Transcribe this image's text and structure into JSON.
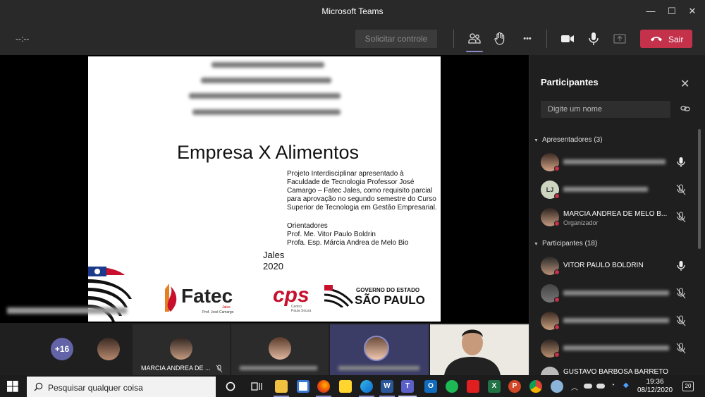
{
  "window": {
    "title": "Microsoft Teams",
    "minimize": "—",
    "maximize": "☐",
    "close": "✕"
  },
  "toolbar": {
    "timer": "--:--",
    "request_control": "Solicitar controle",
    "leave": "Sair",
    "more": "•••",
    "icons": [
      "participants-icon",
      "raise-hand-icon",
      "more-options-icon",
      "camera-icon",
      "microphone-icon",
      "share-tray-icon",
      "hang-up-icon"
    ],
    "leave_color": "#c4314b",
    "accent": "#6264a7"
  },
  "slide": {
    "title": "Empresa X Alimentos",
    "description": "Projeto Interdisciplinar apresentado à Faculdade de Tecnologia Professor José Camargo – Fatec Jales, como requisito parcial para aprovação no segundo semestre do Curso Superior de Tecnologia em Gestão Empresarial.",
    "orientadores_label": "Orientadores",
    "orientador_1": "Prof. Me. Vitor Paulo Boldrin",
    "orientador_2": "Profa. Esp. Márcia Andrea de Melo Bio",
    "city": "Jales",
    "year": "2020",
    "logo_fatec": "Fatec",
    "logo_fatec_sub": "Jales",
    "logo_fatec_sub2": "Prof. José Camargo",
    "logo_cps": "cps",
    "logo_cps_sub1": "Centro",
    "logo_cps_sub2": "Paula Souza",
    "logo_gov_1": "GOVERNO DO ESTADO",
    "logo_gov_2": "SÃO PAULO"
  },
  "gallery": {
    "overflow_count": "+16",
    "tile_name": "MARCIA ANDREA DE ..."
  },
  "panel": {
    "title": "Participantes",
    "search_placeholder": "Digite um nome",
    "presenters_header": "Apresentadores (3)",
    "participants_header": "Participantes (18)",
    "presenters": [
      {
        "initials": "",
        "name": "",
        "role": "",
        "mic": "on"
      },
      {
        "initials": "LJ",
        "name": "",
        "role": "",
        "mic": "muted"
      },
      {
        "initials": "",
        "name": "MARCIA ANDREA DE MELO B...",
        "role": "Organizador",
        "mic": "muted"
      }
    ],
    "participants": [
      {
        "name": "VITOR PAULO BOLDRIN",
        "mic": "on"
      },
      {
        "name": "",
        "mic": "muted"
      },
      {
        "name": "",
        "mic": "muted"
      },
      {
        "name": "",
        "mic": "muted"
      },
      {
        "name": "GUSTAVO BARBOSA BARRETO",
        "mic": "muted"
      }
    ]
  },
  "taskbar": {
    "search_placeholder": "Pesquisar qualquer coisa",
    "time": "19:36",
    "date": "08/12/2020",
    "notifications": "20",
    "apps": [
      "cortana-icon",
      "task-view-icon",
      "file-explorer-icon",
      "store-icon",
      "firefox-icon",
      "sticky-notes-icon",
      "edge-icon",
      "word-icon",
      "teams-icon",
      "outlook-icon",
      "spotify-icon",
      "acrobat-icon",
      "excel-icon",
      "powerpoint-icon",
      "chrome-icon",
      "snipping-icon"
    ]
  }
}
